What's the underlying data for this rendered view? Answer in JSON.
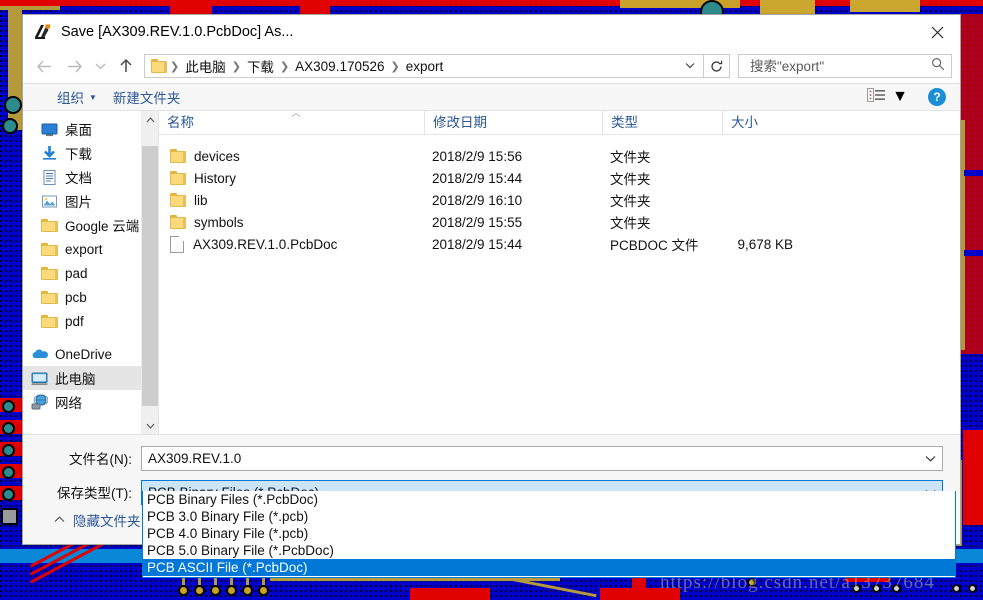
{
  "window": {
    "title": "Save [AX309.REV.1.0.PcbDoc] As...",
    "app_icon": "altium-icon",
    "close_icon": "close-icon"
  },
  "nav": {
    "back_icon": "back-arrow-icon",
    "forward_icon": "forward-arrow-icon",
    "history_icon": "recent-locations-chevron-icon",
    "up_icon": "up-arrow-icon",
    "breadcrumb_folder_icon": "folder-icon",
    "breadcrumb": [
      "此电脑",
      "下载",
      "AX309.170526",
      "export"
    ],
    "breadcrumb_caret_icon": "chevron-down-icon",
    "refresh_icon": "refresh-icon"
  },
  "search": {
    "placeholder": "搜索\"export\"",
    "value": "",
    "icon": "search-icon"
  },
  "commandbar": {
    "organize_label": "组织",
    "organize_caret": "▼",
    "new_folder_label": "新建文件夹",
    "view_icon": "view-layout-icon",
    "view_caret": "▼",
    "help_label": "?"
  },
  "sidebar": {
    "items": [
      {
        "label": "桌面",
        "icon": "desktop-icon",
        "pinned": true,
        "selected": false
      },
      {
        "label": "下载",
        "icon": "downloads-icon",
        "pinned": true,
        "selected": false
      },
      {
        "label": "文档",
        "icon": "documents-icon",
        "pinned": true,
        "selected": false
      },
      {
        "label": "图片",
        "icon": "pictures-icon",
        "pinned": true,
        "selected": false
      },
      {
        "label": "Google 云端",
        "icon": "folder-icon",
        "pinned": true,
        "selected": false
      },
      {
        "label": "export",
        "icon": "folder-icon",
        "pinned": false,
        "selected": false
      },
      {
        "label": "pad",
        "icon": "folder-icon",
        "pinned": false,
        "selected": false
      },
      {
        "label": "pcb",
        "icon": "folder-icon",
        "pinned": false,
        "selected": false
      },
      {
        "label": "pdf",
        "icon": "folder-icon",
        "pinned": false,
        "selected": false
      },
      {
        "label": "OneDrive",
        "icon": "onedrive-cloud-icon",
        "pinned": false,
        "selected": false
      },
      {
        "label": "此电脑",
        "icon": "this-pc-icon",
        "pinned": false,
        "selected": true
      },
      {
        "label": "网络",
        "icon": "network-icon",
        "pinned": false,
        "selected": false
      }
    ],
    "scroll_up_icon": "chevron-up-icon",
    "scroll_down_icon": "chevron-down-icon"
  },
  "filelist": {
    "columns": [
      "名称",
      "修改日期",
      "类型",
      "大小"
    ],
    "sorted_column": "名称",
    "sort_icon": "sort-ascending-icon",
    "rows": [
      {
        "name": "devices",
        "icon": "folder-icon",
        "date": "2018/2/9 15:56",
        "type": "文件夹",
        "size": ""
      },
      {
        "name": "History",
        "icon": "folder-icon",
        "date": "2018/2/9 15:44",
        "type": "文件夹",
        "size": ""
      },
      {
        "name": "lib",
        "icon": "folder-icon",
        "date": "2018/2/9 16:10",
        "type": "文件夹",
        "size": ""
      },
      {
        "name": "symbols",
        "icon": "folder-icon",
        "date": "2018/2/9 15:55",
        "type": "文件夹",
        "size": ""
      },
      {
        "name": "AX309.REV.1.0.PcbDoc",
        "icon": "file-icon",
        "date": "2018/2/9 15:44",
        "type": "PCBDOC 文件",
        "size": "9,678 KB"
      }
    ]
  },
  "form": {
    "filename_label": "文件名(N):",
    "filename_value": "AX309.REV.1.0",
    "filetype_label": "保存类型(T):",
    "filetype_value": "PCB Binary Files (*.PcbDoc)",
    "chevron_icon": "chevron-down-icon",
    "hide_folders_label": "隐藏文件夹",
    "hide_folders_icon": "chevron-up-icon"
  },
  "dropdown": {
    "options": [
      "PCB Binary Files (*.PcbDoc)",
      "PCB 3.0 Binary File (*.pcb)",
      "PCB 4.0 Binary File (*.pcb)",
      "PCB 5.0 Binary File (*.PcbDoc)",
      "PCB ASCII File (*.PcbDoc)"
    ],
    "selected_index": 4
  },
  "watermark": {
    "text": "https://blog.csdn.net/a13737684"
  },
  "colors": {
    "accent": "#0078d7",
    "link": "#2b5797",
    "selection_fill": "#cce4f7",
    "pcb_background": "#0000cc",
    "pcb_trace_red": "#e00000",
    "pcb_trace_gold": "#b59a3c"
  }
}
